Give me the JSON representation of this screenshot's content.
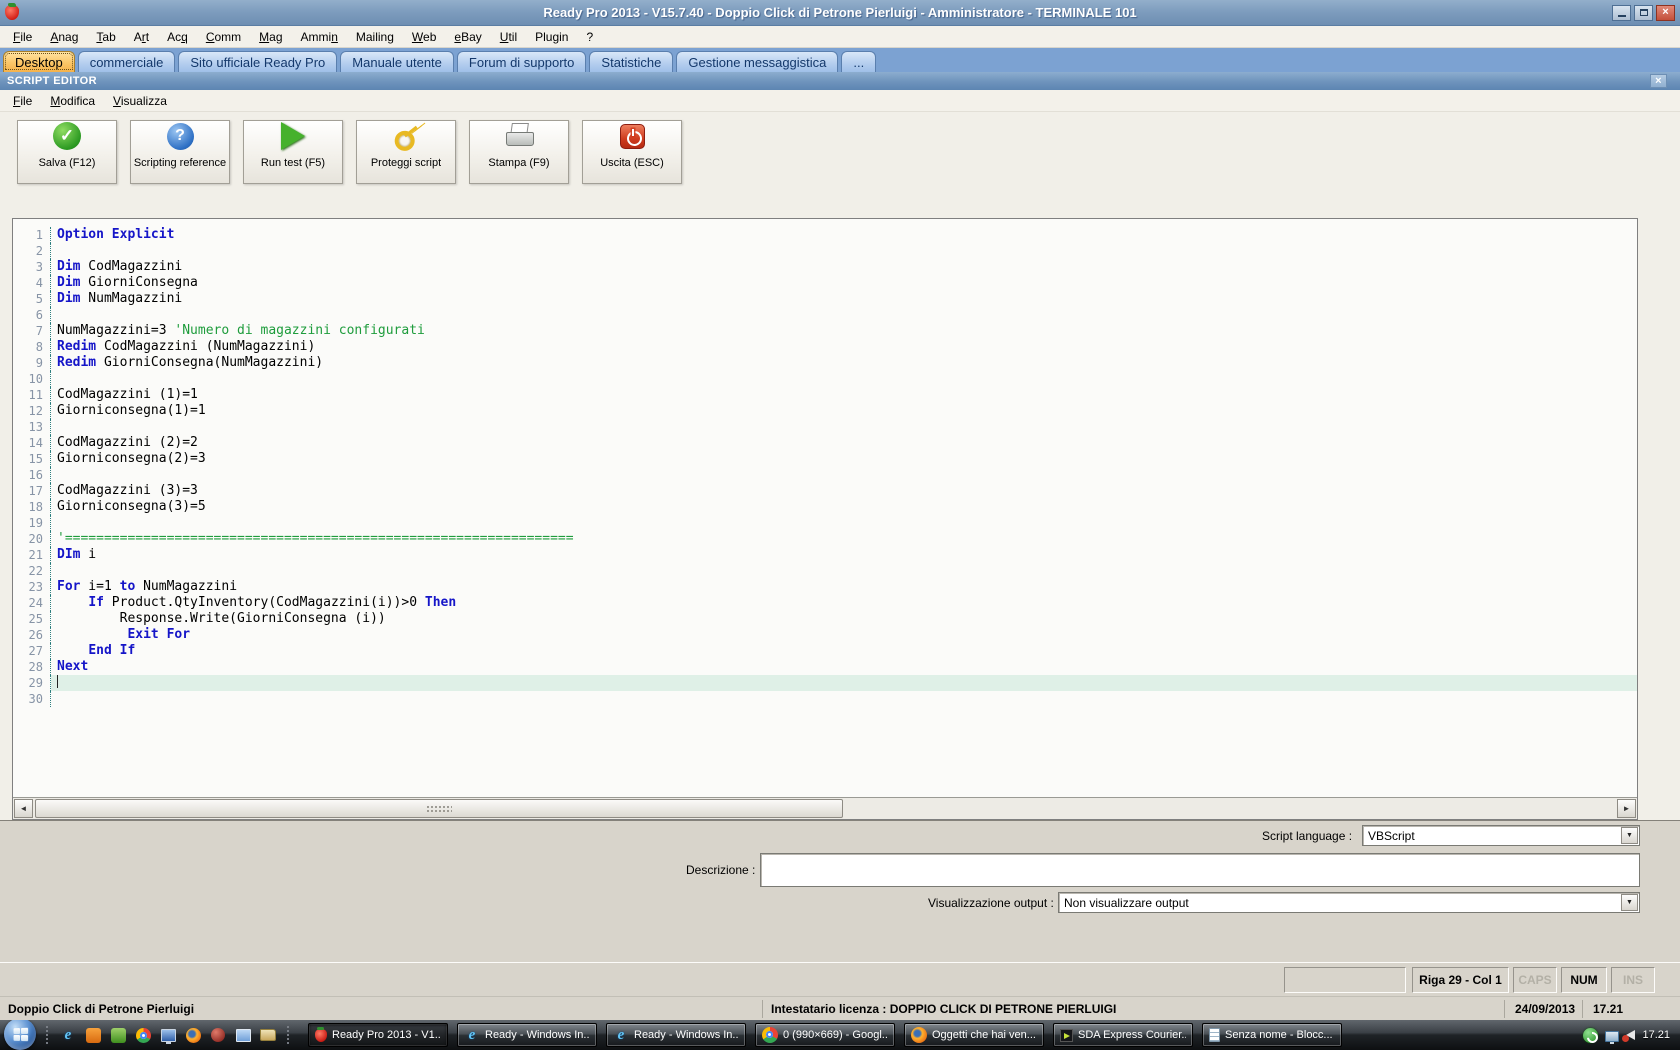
{
  "titlebar": {
    "title": "Ready Pro 2013 - V15.7.40 - Doppio Click di Petrone Pierluigi - Amministratore - TERMINALE 101"
  },
  "main_menu": [
    {
      "label": "File",
      "u": 0
    },
    {
      "label": "Anag",
      "u": 0
    },
    {
      "label": "Tab",
      "u": 0
    },
    {
      "label": "Art",
      "u": 1
    },
    {
      "label": "Acq",
      "u": 2
    },
    {
      "label": "Comm",
      "u": 0
    },
    {
      "label": "Mag",
      "u": 0
    },
    {
      "label": "Ammin",
      "u": 4
    },
    {
      "label": "Mailing",
      "u": 6
    },
    {
      "label": "Web",
      "u": 0
    },
    {
      "label": "eBay",
      "u": 0
    },
    {
      "label": "Util",
      "u": 0
    },
    {
      "label": "Plugin",
      "u": -1
    },
    {
      "label": "?",
      "u": -1
    }
  ],
  "tabs": [
    {
      "label": "Desktop",
      "active": true
    },
    {
      "label": "commerciale",
      "active": false
    },
    {
      "label": "Sito ufficiale Ready Pro",
      "active": false
    },
    {
      "label": "Manuale utente",
      "active": false
    },
    {
      "label": "Forum di supporto",
      "active": false
    },
    {
      "label": "Statistiche",
      "active": false
    },
    {
      "label": "Gestione messaggistica",
      "active": false
    },
    {
      "label": "...",
      "active": false
    }
  ],
  "script_editor": {
    "title": "SCRIPT EDITOR",
    "close_glyph": "✕",
    "menu": [
      {
        "label": "File",
        "u": 0
      },
      {
        "label": "Modifica",
        "u": 0
      },
      {
        "label": "Visualizza",
        "u": 0
      }
    ],
    "toolbar": [
      {
        "label": "Salva (F12)",
        "icon": "save-icon",
        "glyph": "✓"
      },
      {
        "label": "Scripting reference",
        "icon": "help-icon",
        "glyph": "?"
      },
      {
        "label": "Run test (F5)",
        "icon": "run-icon",
        "glyph": ""
      },
      {
        "label": "Proteggi script",
        "icon": "key-icon",
        "glyph": ""
      },
      {
        "label": "Stampa (F9)",
        "icon": "print-icon",
        "glyph": ""
      },
      {
        "label": "Uscita (ESC)",
        "icon": "exit-icon",
        "glyph": ""
      }
    ],
    "code": {
      "current_line": 29,
      "lines": [
        {
          "n": 1,
          "seg": [
            [
              "k",
              "Option Explicit"
            ]
          ]
        },
        {
          "n": 2,
          "seg": []
        },
        {
          "n": 3,
          "seg": [
            [
              "k",
              "Dim"
            ],
            [
              "p",
              " CodMagazzini"
            ]
          ]
        },
        {
          "n": 4,
          "seg": [
            [
              "k",
              "Dim"
            ],
            [
              "p",
              " GiorniConsegna"
            ]
          ]
        },
        {
          "n": 5,
          "seg": [
            [
              "k",
              "Dim"
            ],
            [
              "p",
              " NumMagazzini"
            ]
          ]
        },
        {
          "n": 6,
          "seg": []
        },
        {
          "n": 7,
          "seg": [
            [
              "p",
              "NumMagazzini=3 "
            ],
            [
              "c",
              "'Numero di magazzini configurati"
            ]
          ]
        },
        {
          "n": 8,
          "seg": [
            [
              "k",
              "Redim"
            ],
            [
              "p",
              " CodMagazzini (NumMagazzini)"
            ]
          ]
        },
        {
          "n": 9,
          "seg": [
            [
              "k",
              "Redim"
            ],
            [
              "p",
              " GiorniConsegna(NumMagazzini)"
            ]
          ]
        },
        {
          "n": 10,
          "seg": []
        },
        {
          "n": 11,
          "seg": [
            [
              "p",
              "CodMagazzini (1)=1"
            ]
          ]
        },
        {
          "n": 12,
          "seg": [
            [
              "p",
              "Giorniconsegna(1)=1"
            ]
          ]
        },
        {
          "n": 13,
          "seg": []
        },
        {
          "n": 14,
          "seg": [
            [
              "p",
              "CodMagazzini (2)=2"
            ]
          ]
        },
        {
          "n": 15,
          "seg": [
            [
              "p",
              "Giorniconsegna(2)=3"
            ]
          ]
        },
        {
          "n": 16,
          "seg": []
        },
        {
          "n": 17,
          "seg": [
            [
              "p",
              "CodMagazzini (3)=3"
            ]
          ]
        },
        {
          "n": 18,
          "seg": [
            [
              "p",
              "Giorniconsegna(3)=5"
            ]
          ]
        },
        {
          "n": 19,
          "seg": []
        },
        {
          "n": 20,
          "seg": [
            [
              "c",
              "'================================================================="
            ]
          ]
        },
        {
          "n": 21,
          "seg": [
            [
              "k",
              "DIm"
            ],
            [
              "p",
              " i"
            ]
          ]
        },
        {
          "n": 22,
          "seg": []
        },
        {
          "n": 23,
          "seg": [
            [
              "k",
              "For"
            ],
            [
              "p",
              " i=1 "
            ],
            [
              "k",
              "to"
            ],
            [
              "p",
              " NumMagazzini"
            ]
          ]
        },
        {
          "n": 24,
          "seg": [
            [
              "p",
              "    "
            ],
            [
              "k",
              "If"
            ],
            [
              "p",
              " Product.QtyInventory(CodMagazzini(i))>0 "
            ],
            [
              "k",
              "Then"
            ]
          ]
        },
        {
          "n": 25,
          "seg": [
            [
              "p",
              "        Response.Write(GiorniConsegna (i))"
            ]
          ]
        },
        {
          "n": 26,
          "seg": [
            [
              "p",
              "         "
            ],
            [
              "k",
              "Exit For"
            ]
          ]
        },
        {
          "n": 27,
          "seg": [
            [
              "p",
              "    "
            ],
            [
              "k",
              "End If"
            ]
          ]
        },
        {
          "n": 28,
          "seg": [
            [
              "k",
              "Next"
            ]
          ]
        },
        {
          "n": 29,
          "seg": []
        },
        {
          "n": 30,
          "seg": []
        }
      ]
    },
    "fields": {
      "script_language_label": "Script language :",
      "script_language_value": "VBScript",
      "description_label": "Descrizione :",
      "description_value": "",
      "output_label": "Visualizzazione output :",
      "output_value": "Non visualizzare output"
    }
  },
  "status_bar": {
    "position": "Riga 29 - Col 1",
    "caps": "CAPS",
    "num": "NUM",
    "ins": "INS"
  },
  "info_bar": {
    "owner": "Doppio Click di Petrone Pierluigi",
    "license": "Intestatario licenza : DOPPIO CLICK DI PETRONE PIERLUIGI",
    "date": "24/09/2013",
    "time": "17.21"
  },
  "taskbar": {
    "quick_launch": [
      {
        "icon": "ie",
        "name": "internet-explorer-icon"
      },
      {
        "icon": "orange",
        "name": "orange-app-icon"
      },
      {
        "icon": "green",
        "name": "green-app-icon"
      },
      {
        "icon": "chrome",
        "name": "chrome-icon"
      },
      {
        "icon": "monitor",
        "name": "monitor-icon"
      },
      {
        "icon": "firefox",
        "name": "firefox-icon"
      },
      {
        "icon": "redorb",
        "name": "red-orb-app-icon"
      },
      {
        "icon": "explorer",
        "name": "windows-explorer-icon"
      },
      {
        "icon": "folder",
        "name": "folder-icon"
      }
    ],
    "buttons": [
      {
        "label": "Ready Pro 2013 - V1...",
        "icon": "strawberry",
        "active": true
      },
      {
        "label": "Ready - Windows In...",
        "icon": "ie",
        "active": false
      },
      {
        "label": "Ready - Windows In...",
        "icon": "ie",
        "active": false
      },
      {
        "label": "0 (990×669) - Googl...",
        "icon": "chrome",
        "active": false
      },
      {
        "label": "Oggetti che hai ven...",
        "icon": "firefox",
        "active": false
      },
      {
        "label": "SDA Express Courier...",
        "icon": "sda",
        "active": false
      },
      {
        "label": "Senza nome - Blocc...",
        "icon": "notepad",
        "active": false
      }
    ],
    "tray_time": "17.21"
  },
  "colors": {
    "titlebar_blue": "#7E9DBE",
    "tabstrip_blue": "#7CA2D2",
    "active_tab_orange": "#FBC667",
    "keyword_blue": "#1515C8",
    "comment_green": "#1E9C3C",
    "current_line_highlight": "#DFF0E7",
    "panel_gray": "#D8D4CB"
  }
}
